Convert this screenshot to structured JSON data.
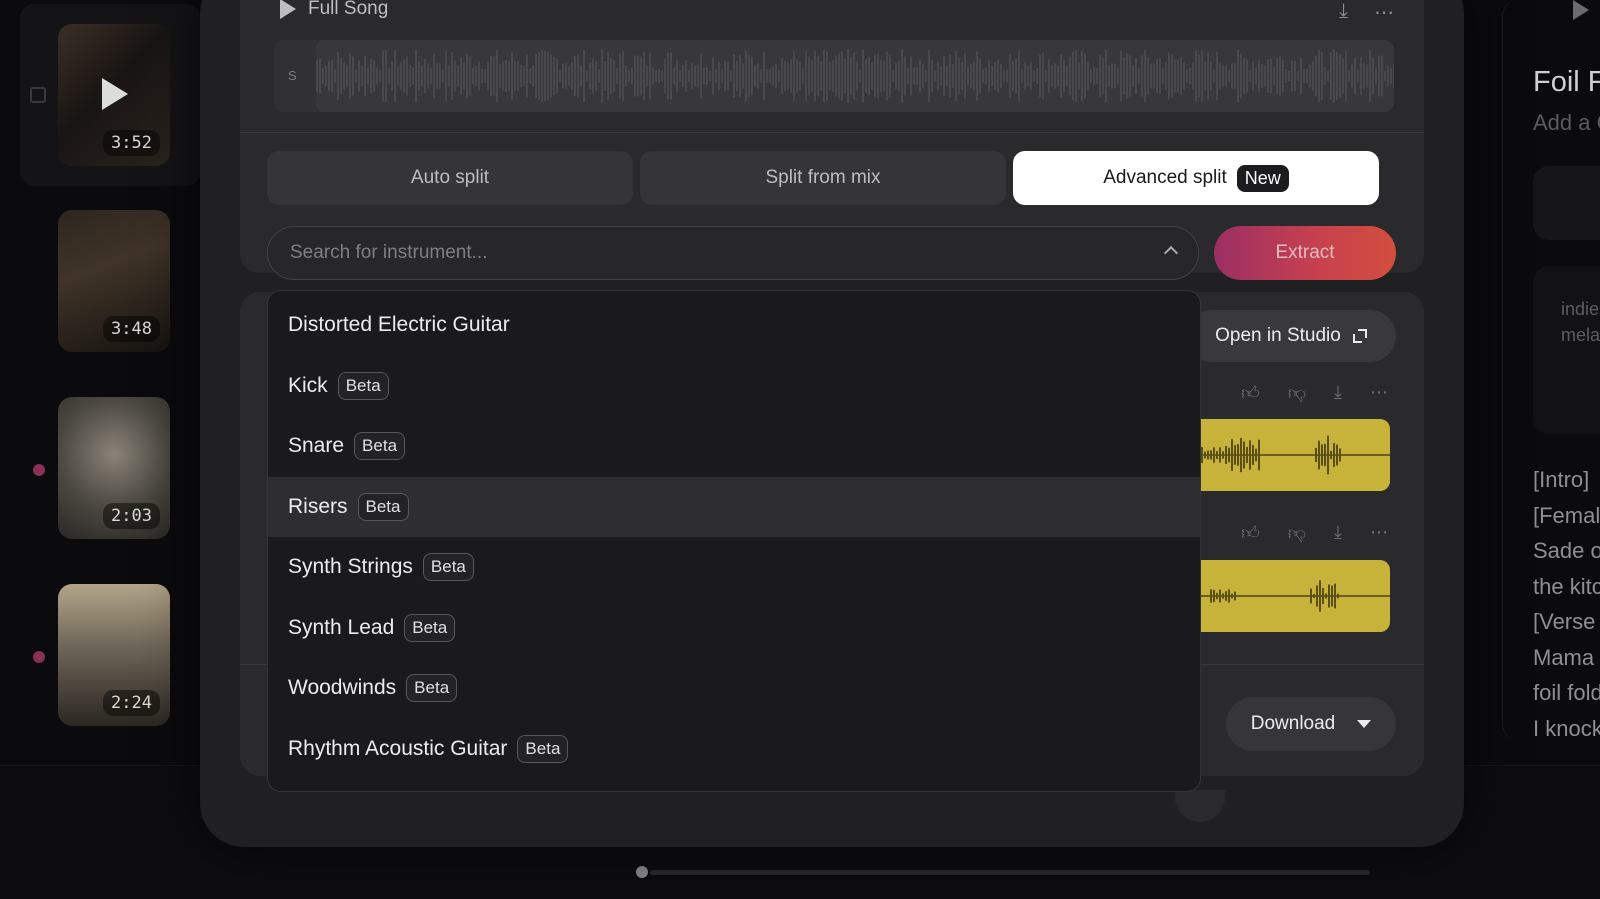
{
  "library": {
    "tracks": [
      {
        "duration": "3:52"
      },
      {
        "duration": "3:48"
      },
      {
        "duration": "2:03"
      },
      {
        "duration": "2:24"
      }
    ]
  },
  "song": {
    "title": "Full Song",
    "wave_label": "S"
  },
  "split": {
    "tabs": [
      {
        "label": "Auto split"
      },
      {
        "label": "Split from mix"
      },
      {
        "label": "Advanced split",
        "badge": "New"
      }
    ],
    "search_placeholder": "Search for instrument...",
    "extract_label": "Extract"
  },
  "dropdown": {
    "options": [
      {
        "label": "Distorted Electric Guitar",
        "badge": ""
      },
      {
        "label": "Kick",
        "badge": "Beta"
      },
      {
        "label": "Snare",
        "badge": "Beta"
      },
      {
        "label": "Risers",
        "badge": "Beta"
      },
      {
        "label": "Synth Strings",
        "badge": "Beta"
      },
      {
        "label": "Synth Lead",
        "badge": "Beta"
      },
      {
        "label": "Woodwinds",
        "badge": "Beta"
      },
      {
        "label": "Rhythm Acoustic Guitar",
        "badge": "Beta"
      }
    ],
    "hovered_index": 3
  },
  "stems": {
    "open_studio_label": "Open in Studio",
    "download_label": "Download"
  },
  "right_panel": {
    "title": "Foil F",
    "subtitle": "Add a C",
    "tags": [
      "indie",
      "mela"
    ],
    "lyrics": [
      "[Intro]",
      "[Femal",
      "Sade o",
      "the kitc",
      "[Verse",
      "Mama",
      "foil fold",
      "I knock"
    ]
  },
  "icons": {
    "play": "play-icon",
    "download": "download-icon",
    "more": "more-icon",
    "thumb_up": "thumbs-up-icon",
    "thumb_down": "thumbs-down-icon",
    "chevron_up": "chevron-up-icon",
    "expand": "expand-icon",
    "caret_down": "caret-down-icon"
  },
  "colors": {
    "accent_gradient_start": "#9b2f63",
    "accent_gradient_end": "#d24e3d",
    "stem_wave": "#c8b33a",
    "selected_tab_bg": "#ffffff"
  }
}
